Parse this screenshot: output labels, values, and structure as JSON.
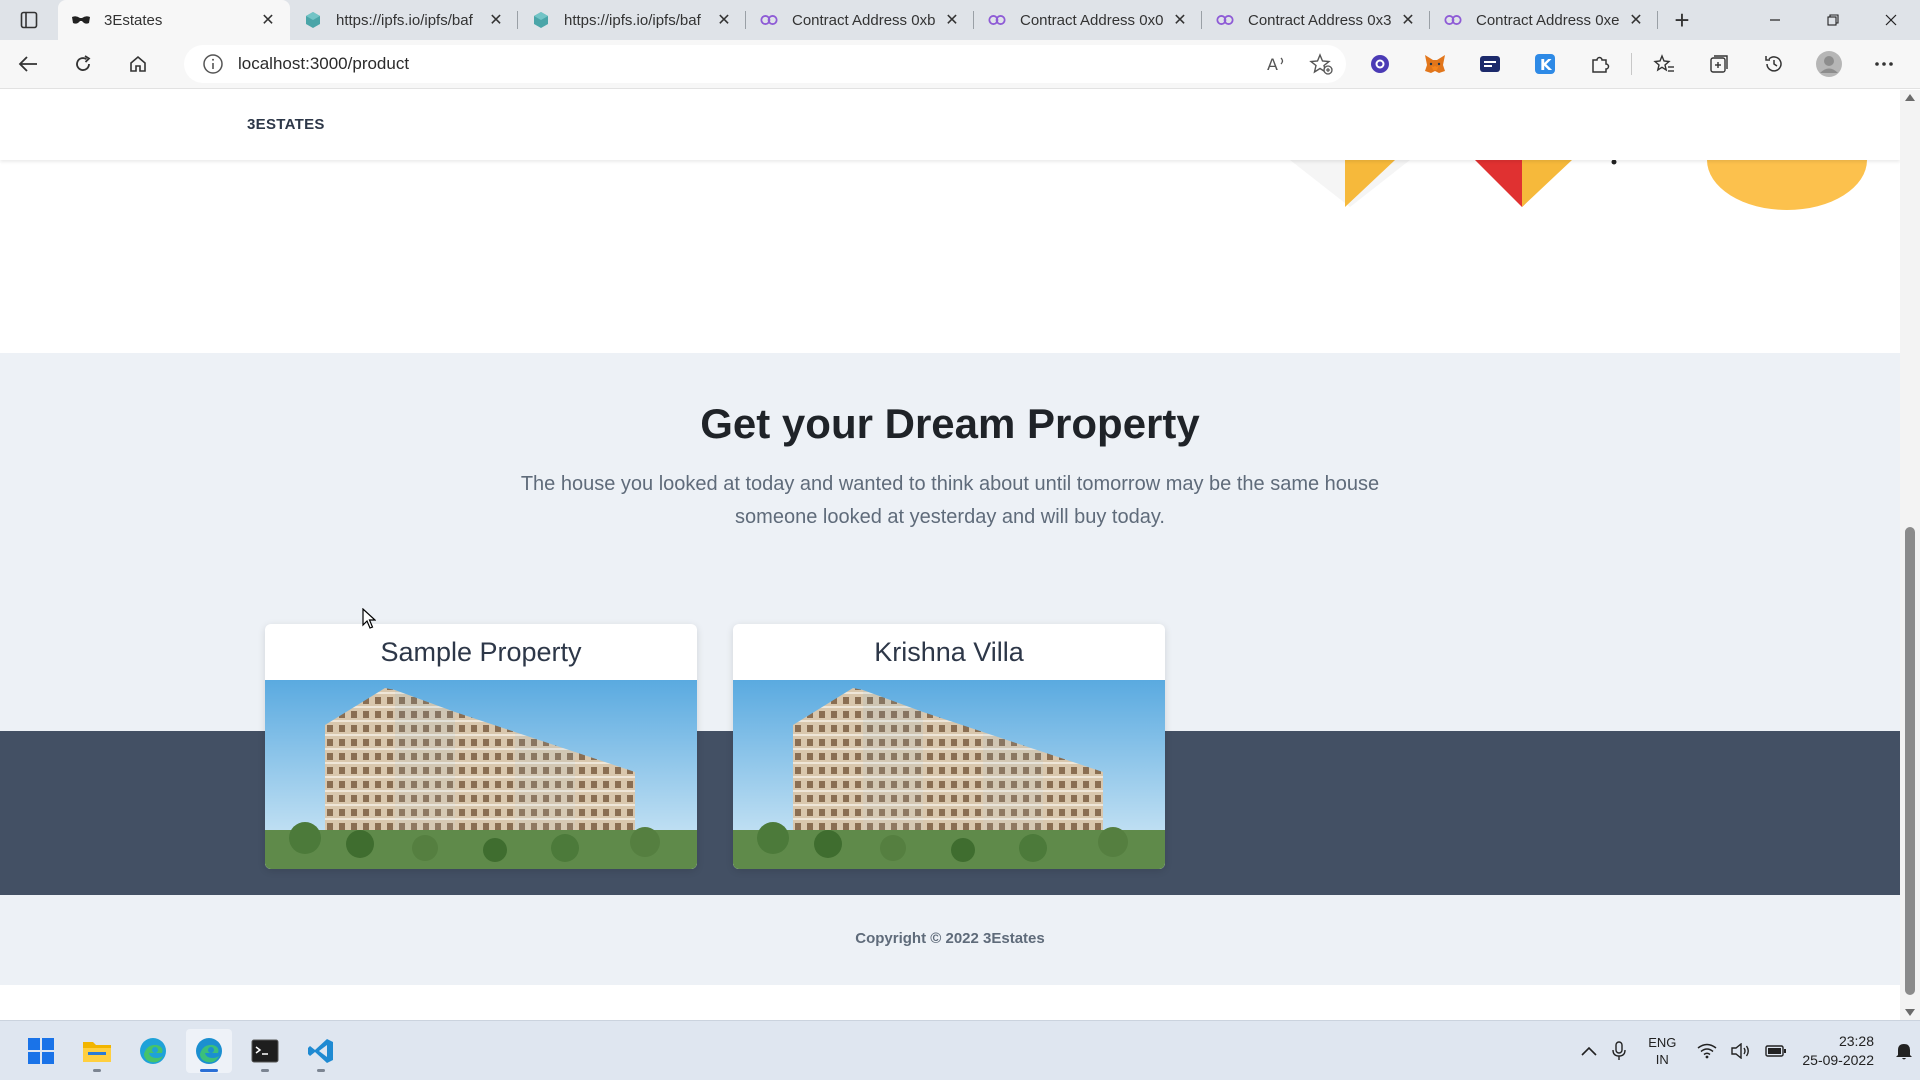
{
  "browser": {
    "tabs": [
      {
        "title": "3Estates",
        "favicon": "mask-icon",
        "active": true
      },
      {
        "title": "https://ipfs.io/ipfs/baf",
        "favicon": "cube-icon",
        "active": false
      },
      {
        "title": "https://ipfs.io/ipfs/baf",
        "favicon": "cube-icon",
        "active": false
      },
      {
        "title": "Contract Address 0xb",
        "favicon": "chain-link-icon",
        "active": false
      },
      {
        "title": "Contract Address 0x0",
        "favicon": "chain-link-icon",
        "active": false
      },
      {
        "title": "Contract Address 0x3",
        "favicon": "chain-link-icon",
        "active": false
      },
      {
        "title": "Contract Address 0xe",
        "favicon": "chain-link-icon",
        "active": false
      }
    ],
    "url": "localhost:3000/product"
  },
  "site": {
    "brand": "3ESTATES",
    "heading": "Get your Dream Property",
    "subtext_line1": "The house you looked at today and wanted to think about until tomorrow may be the same house",
    "subtext_line2": "someone looked at yesterday and will buy today.",
    "cards": [
      {
        "title": "Sample Property",
        "image": "apartment-building-image"
      },
      {
        "title": "Krishna Villa",
        "image": "apartment-building-image"
      }
    ],
    "footer": "Copyright © 2022 3Estates"
  },
  "taskbar": {
    "lang_top": "ENG",
    "lang_bottom": "IN",
    "time": "23:28",
    "date": "25-09-2022"
  },
  "colors": {
    "section_bg": "#edf1f6",
    "dark_band": "#435064",
    "accent_orange": "#f6b93b",
    "accent_red": "#e03131"
  }
}
